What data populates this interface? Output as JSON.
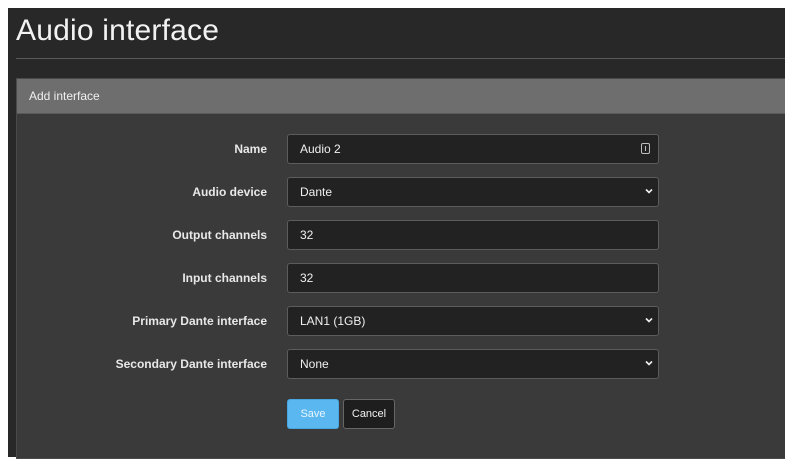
{
  "page": {
    "title": "Audio interface"
  },
  "panel": {
    "heading": "Add interface"
  },
  "form": {
    "name": {
      "label": "Name",
      "value": "Audio 2"
    },
    "audio_device": {
      "label": "Audio device",
      "value": "Dante"
    },
    "output_channels": {
      "label": "Output channels",
      "value": "32"
    },
    "input_channels": {
      "label": "Input channels",
      "value": "32"
    },
    "primary_dante": {
      "label": "Primary Dante interface",
      "value": "LAN1 (1GB)"
    },
    "secondary_dante": {
      "label": "Secondary Dante interface",
      "value": "None"
    }
  },
  "buttons": {
    "save": "Save",
    "cancel": "Cancel"
  },
  "colors": {
    "accent": "#5bb7f0",
    "panel_heading": "#6e6e6e",
    "background": "#282828"
  }
}
